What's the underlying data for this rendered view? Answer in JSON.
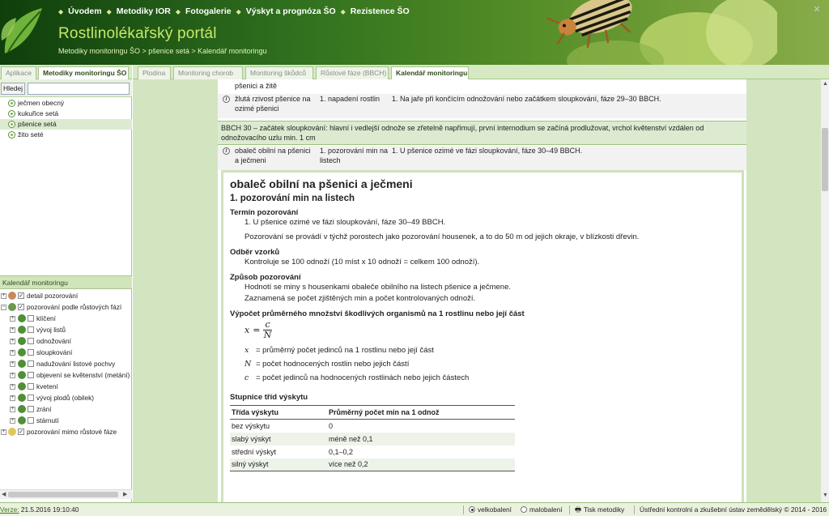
{
  "header": {
    "nav": [
      "Úvodem",
      "Metodiky IOR",
      "Fotogalerie",
      "Výskyt a prognóza ŠO",
      "Rezistence ŠO"
    ],
    "title": "Rostlinolékařský portál",
    "breadcrumb": "Metodiky monitoringu ŠO > pšenice setá > Kalendář monitoringu"
  },
  "left_tabs": [
    {
      "label": "Aplikace"
    },
    {
      "label": "Metodiky monitoringu ŠO"
    }
  ],
  "main_tabs": [
    {
      "label": "Plodina"
    },
    {
      "label": "Monitoring chorob"
    },
    {
      "label": "Monitoring škůdců"
    },
    {
      "label": "Růstové fáze (BBCH)"
    },
    {
      "label": "Kalendář monitoringu"
    }
  ],
  "search": {
    "button": "Hledej",
    "value": ""
  },
  "crops": [
    {
      "label": "ječmen obecný"
    },
    {
      "label": "kukuřice setá"
    },
    {
      "label": "pšenice setá"
    },
    {
      "label": "žito seté"
    }
  ],
  "calendar": {
    "header": "Kalendář monitoringu",
    "tree": [
      {
        "label": "detail pozorování"
      },
      {
        "label": "pozorování podle růstových fází"
      },
      {
        "label": "klíčení"
      },
      {
        "label": "vývoj listů"
      },
      {
        "label": "odnožování"
      },
      {
        "label": "sloupkování"
      },
      {
        "label": "nadužování listové pochvy"
      },
      {
        "label": "objevení se květenství (metání)"
      },
      {
        "label": "kvetení"
      },
      {
        "label": "vývoj plodů (obilek)"
      },
      {
        "label": "zrání"
      },
      {
        "label": "stárnutí"
      },
      {
        "label": "pozorování mimo růstové fáze"
      }
    ]
  },
  "rows": [
    {
      "pest": "pšenici a žitě",
      "method": "",
      "text": ""
    },
    {
      "pest": "žlutá rzivost pšenice na ozimé pšenici",
      "method": "1. napadení rostlin",
      "text": "1. Na jaře při končícím odnožování nebo začátkem sloupkování, fáze 29–30 BBCH."
    },
    {
      "pest": "obaleč obilní na pšenici a ječmeni",
      "method": "1. pozorování min na listech",
      "text": "1. U pšenice ozimé ve fázi sloupkování, fáze 30–49 BBCH."
    }
  ],
  "bbch_banner": "BBCH 30 – začátek sloupkování: hlavní i vedlejší odnože se zřetelně napřimují, první internodium se začíná prodlužovat, vrchol květenství vzdálen od odnožovacího uzlu min. 1 cm",
  "detail": {
    "title": "obaleč obilní na pšenici a ječmeni",
    "subtitle": "1. pozorování min na listech",
    "term_heading": "Termín pozorování",
    "term_p1": "1. U pšenice ozimé ve fázi sloupkování, fáze 30–49 BBCH.",
    "term_p2": "Pozorování se provádí v týchž porostech jako pozorování housenek, a to do 50 m od jejich okraje, v blízkosti dřevin.",
    "sample_heading": "Odběr vzorků",
    "sample_p": "Kontroluje se 100 odnoží (10 míst x 10 odnoží = celkem 100 odnoží).",
    "method_heading": "Způsob pozorování",
    "method_p1": "Hodnotí se miny s housenkami obaleče obilního na listech pšenice a ječmene.",
    "method_p2": "Zaznamená se počet zjištěných min a počet kontrolovaných odnoží.",
    "calc_heading": "Výpočet průměrného množství škodlivých organismů na 1 rostlinu nebo její část",
    "formula": {
      "lhs": "x",
      "eq": "=",
      "num": "c",
      "den": "N"
    },
    "vars": [
      {
        "sym": "x",
        "text": "= průměrný počet jedinců na 1 rostlinu nebo její část"
      },
      {
        "sym": "N",
        "text": "= počet hodnocených rostlin nebo jejich částí"
      },
      {
        "sym": "c",
        "text": "= počet jedinců na hodnocených rostlinách nebo jejich částech"
      }
    ],
    "scale_heading": "Stupnice tříd výskytu",
    "scale_cols": [
      "Třída výskytu",
      "Průměrný počet min na 1 odnož"
    ],
    "scale_rows": [
      [
        "bez výskytu",
        "0"
      ],
      [
        "slabý výskyt",
        "méně než 0,1"
      ],
      [
        "střední výskyt",
        "0,1–0,2"
      ],
      [
        "silný výskyt",
        "více než 0,2"
      ]
    ]
  },
  "footer": {
    "version_key": "Verze:",
    "version_val": "21.5.2016 19:10:40",
    "opt_big": "velkobalení",
    "opt_small": "malobalení",
    "print": "Tisk metodiky",
    "copyright": "Ústřední kontrolní a zkušební ústav zemědělský © 2014 - 2016"
  }
}
